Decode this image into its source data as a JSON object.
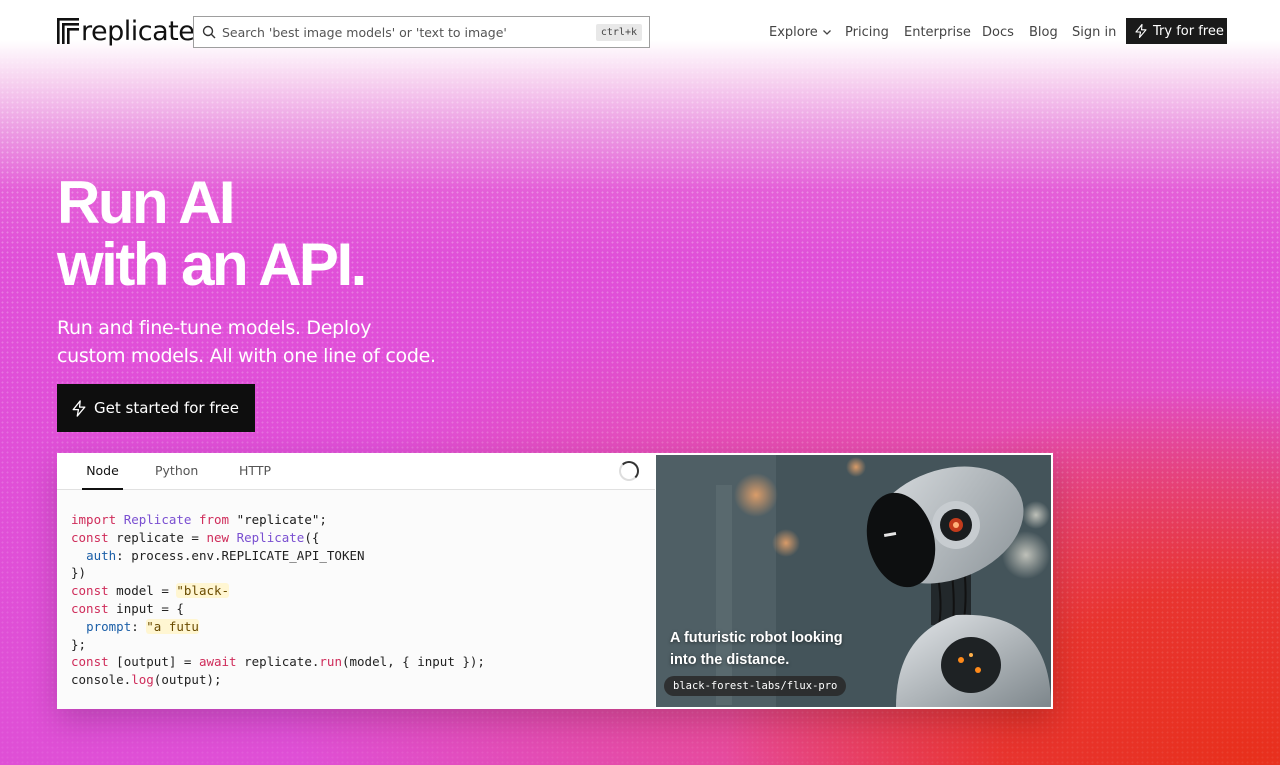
{
  "brand": {
    "name": "replicate"
  },
  "search": {
    "placeholder": "Search 'best image models' or 'text to image'",
    "shortcut": "ctrl+k"
  },
  "nav": {
    "explore": "Explore",
    "pricing": "Pricing",
    "enterprise": "Enterprise",
    "docs": "Docs",
    "blog": "Blog",
    "signin": "Sign in",
    "try": "Try for free"
  },
  "hero": {
    "title_line1": "Run AI",
    "title_line2": "with an API.",
    "sub_line1": "Run and fine-tune models. Deploy",
    "sub_line2": "custom models. All with one line of code.",
    "cta": "Get started for free"
  },
  "code_panel": {
    "tabs": [
      "Node",
      "Python",
      "HTTP"
    ],
    "active_tab": "Node",
    "lines": [
      "import Replicate from \"replicate\";",
      "const replicate = new Replicate({",
      "  auth: process.env.REPLICATE_API_TOKEN",
      "})",
      "const model = \"black-",
      "const input = {",
      "  prompt: \"a futu",
      "};",
      "const [output] = await replicate.run(model, { input });",
      "console.log(output);"
    ],
    "image_caption": "A futuristic robot looking into the distance.",
    "model_name": "black-forest-labs/flux-pro"
  },
  "colors": {
    "accent_dark": "#0e0e0e",
    "pink": "#df4fd6",
    "red": "#e8301c"
  }
}
